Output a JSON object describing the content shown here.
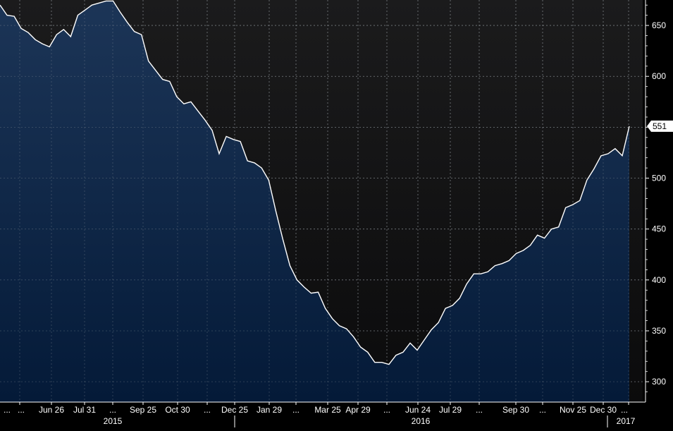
{
  "colors": {
    "background": "#000000",
    "plot_top": "#1b1b1c",
    "plot_bottom": "#0b0b0c",
    "area_top": "#1c3557",
    "area_bottom": "#041a38",
    "line": "#ffffff",
    "grid": "#9aa0a6",
    "text": "#ffffff",
    "label_box_bg": "#ffffff",
    "label_box_text": "#000000"
  },
  "chart_data": {
    "type": "area",
    "title": "",
    "xlabel": "",
    "ylabel": "",
    "ylim": [
      280,
      675
    ],
    "y_ticks": [
      300,
      350,
      400,
      450,
      500,
      550,
      600,
      650
    ],
    "y_axis_side": "right",
    "grid": true,
    "last_value_label": "551",
    "x_tick_labels": [
      "...",
      "...",
      "Jun 26",
      "Jul 31",
      "...",
      "Sep 25",
      "Oct 30",
      "...",
      "Dec 25",
      "Jan 29",
      "...",
      "Mar 25",
      "Apr 29",
      "...",
      "Jun 24",
      "Jul 29",
      "...",
      "Sep 30",
      "...",
      "Nov 25",
      "Dec 30",
      "..."
    ],
    "year_labels": [
      "2015",
      "2016",
      "2017"
    ],
    "series": [
      {
        "values": [
          670,
          660,
          659,
          647,
          643,
          636,
          632,
          629,
          641,
          646,
          639,
          660,
          665,
          670,
          672,
          674,
          674,
          663,
          653,
          644,
          641,
          615,
          606,
          597,
          595,
          580,
          573,
          575,
          566,
          557,
          547,
          524,
          541,
          538,
          536,
          517,
          515,
          510,
          498,
          468,
          440,
          414,
          400,
          393,
          387,
          388,
          372,
          362,
          355,
          352,
          344,
          334,
          329,
          319,
          319,
          317,
          326,
          329,
          338,
          331,
          341,
          351,
          358,
          372,
          375,
          382,
          396,
          406,
          406,
          408,
          414,
          416,
          419,
          426,
          429,
          434,
          444,
          441,
          450,
          452,
          471,
          474,
          478,
          498,
          509,
          522,
          524,
          529,
          522,
          551
        ]
      }
    ]
  }
}
